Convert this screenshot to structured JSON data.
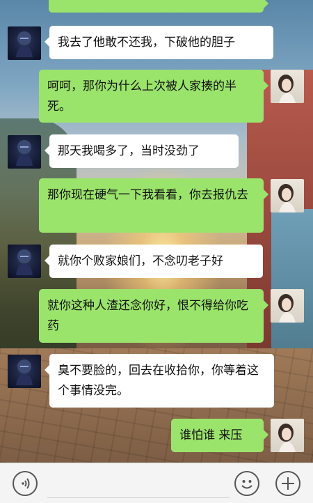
{
  "messages": [
    {
      "side": "left",
      "text": "我去了他敢不还我，下破他的胆子"
    },
    {
      "side": "right",
      "text": "呵呵，那你为什么上次被人家揍的半死。"
    },
    {
      "side": "left",
      "text": "那天我喝多了，当时没劲了"
    },
    {
      "side": "right",
      "text": "那你现在硬气一下我看看，你去报仇去"
    },
    {
      "side": "left",
      "text": "就你个败家娘们，不念叨老子好"
    },
    {
      "side": "right",
      "text": "就你这种人渣还念你好，恨不得给你吃药"
    },
    {
      "side": "left",
      "text": "臭不要脸的，回去在收拾你，你等着这个事情没完。"
    },
    {
      "side": "right",
      "text": "谁怕谁 来压"
    }
  ],
  "toolbar": {
    "voice_icon": "voice-icon",
    "emoji_icon": "emoji-icon",
    "plus_icon": "plus-icon"
  },
  "colors": {
    "bubble_sent": "#9be46c",
    "bubble_received": "#ffffff",
    "toolbar_bg": "#f4f4f4"
  }
}
